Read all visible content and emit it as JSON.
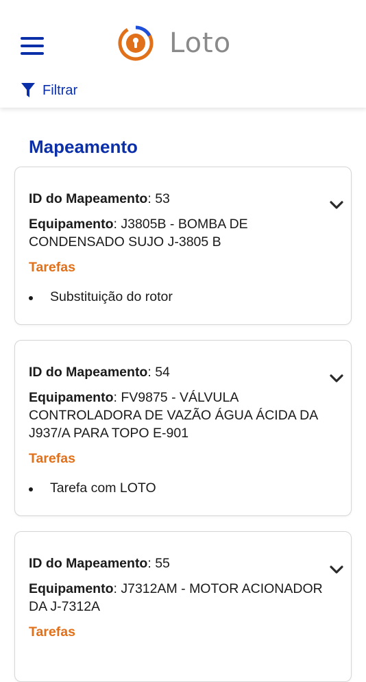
{
  "header": {
    "app_name": "Loto",
    "filter_label": "Filtrar",
    "menu_icon": "hamburger-menu-icon",
    "filter_icon": "funnel-icon",
    "brand_color": "#0a2fa8",
    "accent_color": "#e0701a"
  },
  "section_title": "Mapeamento",
  "labels": {
    "id": "ID do Mapeamento",
    "equipment": "Equipamento",
    "tasks": "Tarefas"
  },
  "cards": [
    {
      "id": "53",
      "equipment": "J3805B - BOMBA DE CONDENSADO SUJO J-3805 B",
      "tasks": [
        "Substituição do rotor"
      ]
    },
    {
      "id": "54",
      "equipment": "FV9875 - VÁLVULA CONTROLADORA DE VAZÃO ÁGUA ÁCIDA DA J937/A PARA TOPO E-901",
      "tasks": [
        "Tarefa com LOTO"
      ]
    },
    {
      "id": "55",
      "equipment": "J7312AM - MOTOR ACIONADOR DA J-7312A",
      "tasks": []
    }
  ]
}
